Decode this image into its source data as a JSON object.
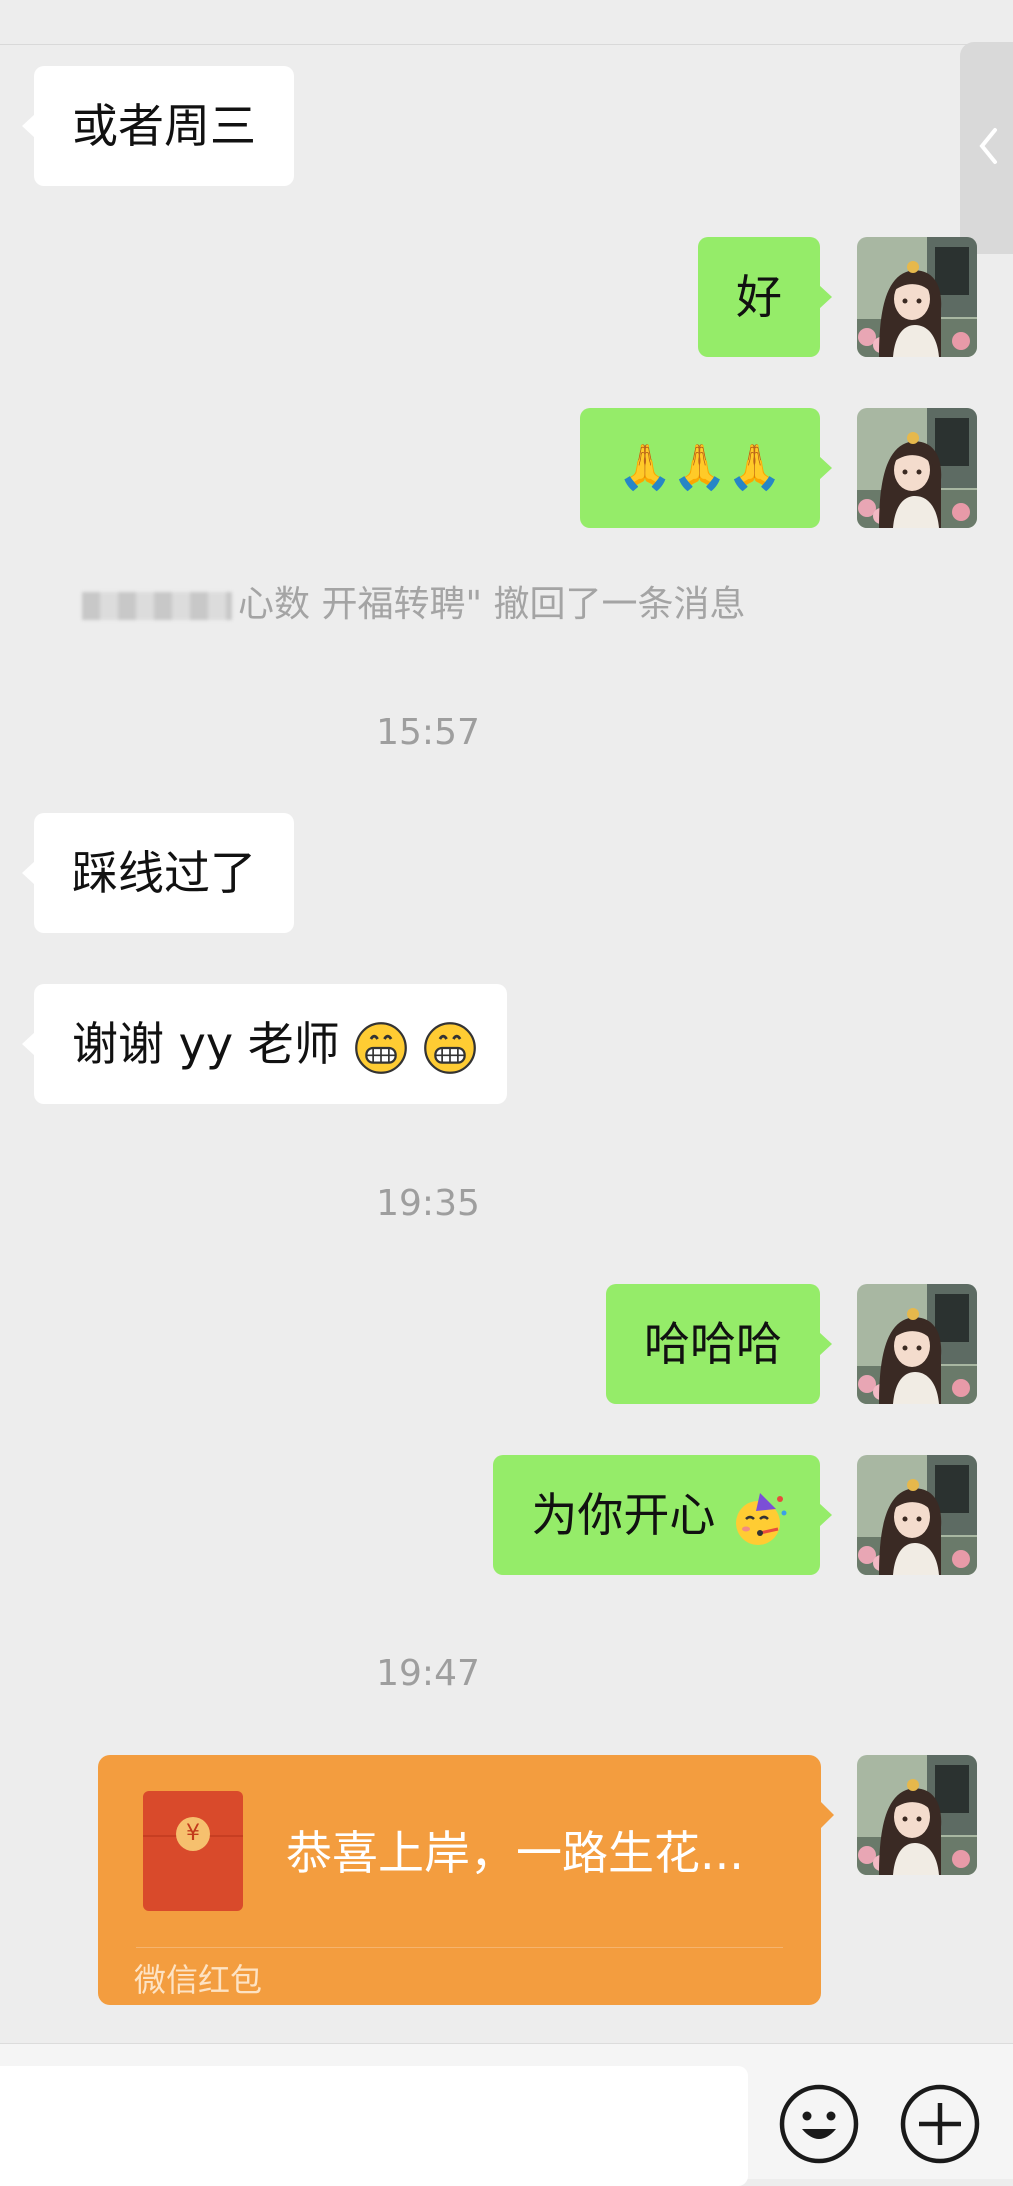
{
  "header": {
    "title_fragment": ""
  },
  "colors": {
    "background": "#ededed",
    "incoming_bubble": "#ffffff",
    "outgoing_bubble": "#95ec69",
    "red_packet": "#f39d3f",
    "system_text": "#a4a4a4"
  },
  "messages": [
    {
      "side": "in",
      "text": "或者周三"
    },
    {
      "side": "out",
      "text": "好"
    },
    {
      "side": "out",
      "text": "🙏🙏🙏"
    }
  ],
  "system_message": {
    "text": "⼼数 开福转聘\" 撤回了一条消息"
  },
  "timestamps": [
    "15:57",
    "19:35",
    "19:47"
  ],
  "messages_2": [
    {
      "side": "in",
      "text": "踩线过了"
    },
    {
      "side": "in",
      "text": "谢谢 yy 老师"
    }
  ],
  "messages_3": [
    {
      "side": "out",
      "text": "哈哈哈"
    },
    {
      "side": "out",
      "text": "为你开心"
    }
  ],
  "red_packet": {
    "message": "恭喜上岸，一路生花...",
    "label": "微信红包",
    "seal_symbol": "¥"
  },
  "icons": {
    "side_tab": "chevron-left-icon",
    "emoji_button": "smiley-face-icon",
    "more_button": "plus-circle-icon",
    "grin_emoji": "grinning-face-icon",
    "party_emoji": "partying-face-icon"
  }
}
